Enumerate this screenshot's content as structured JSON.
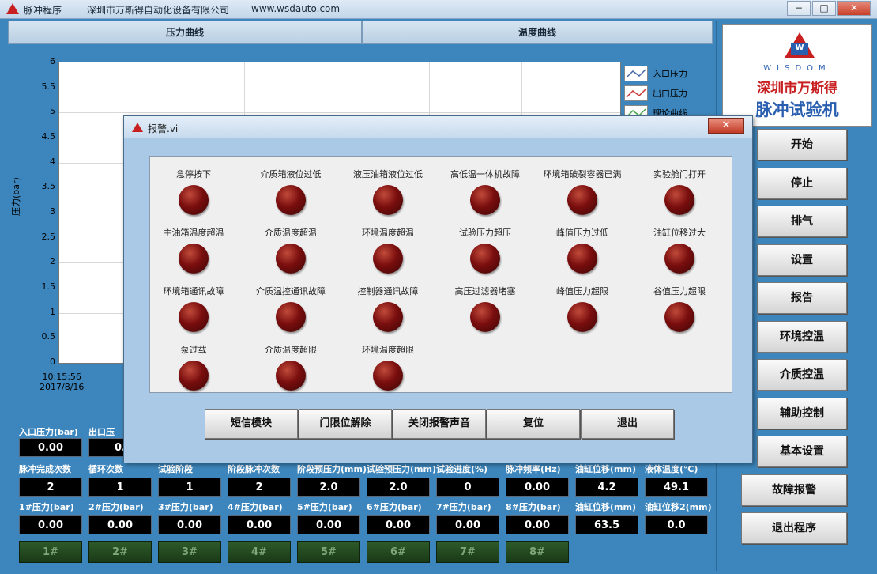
{
  "titlebar": {
    "app_name": "脉冲程序",
    "company": "深圳市万斯得自动化设备有限公司",
    "url": "www.wsdauto.com",
    "min": "−",
    "max": "□",
    "close": "✕"
  },
  "tabs": [
    "压力曲线",
    "温度曲线"
  ],
  "graph": {
    "ylabel": "压力(bar)",
    "yticks": [
      "6",
      "5.5",
      "5",
      "4.5",
      "4",
      "3.5",
      "3",
      "2.5",
      "2",
      "1.5",
      "1",
      "0.5",
      "0"
    ],
    "time": "10:15:56",
    "date": "2017/8/16",
    "legend": [
      "入口压力",
      "出口压力",
      "理论曲线"
    ]
  },
  "brand": {
    "logo_letter": "W",
    "en": "WISDOM",
    "cn1": "深圳市万斯得",
    "cn2": "脉冲试验机"
  },
  "right_buttons": [
    "开始",
    "停止",
    "排气",
    "设置",
    "报告",
    "环境控温",
    "介质控温",
    "辅助控制",
    "基本设置",
    "故障报警",
    "退出程序"
  ],
  "readings": {
    "row0_labels": [
      "入口压力(bar)",
      "出口压"
    ],
    "row0_values": [
      "0.00",
      "0."
    ],
    "row1_labels": [
      "脉冲完成次数",
      "循环次数",
      "试验阶段",
      "阶段脉冲次数",
      "阶段预压力(mm)",
      "试验预压力(mm)",
      "试验进度(%)",
      "脉冲频率(Hz)",
      "油缸位移(mm)",
      "液体温度(℃)"
    ],
    "row1_values": [
      "2",
      "1",
      "1",
      "2",
      "2.0",
      "2.0",
      "0",
      "0.00",
      "4.2",
      "49.1"
    ],
    "row2_labels": [
      "1#压力(bar)",
      "2#压力(bar)",
      "3#压力(bar)",
      "4#压力(bar)",
      "5#压力(bar)",
      "6#压力(bar)",
      "7#压力(bar)",
      "8#压力(bar)",
      "油缸位移(mm)",
      "油缸位移2(mm)"
    ],
    "row2_values": [
      "0.00",
      "0.00",
      "0.00",
      "0.00",
      "0.00",
      "0.00",
      "0.00",
      "0.00",
      "63.5",
      "0.0"
    ],
    "lamps": [
      "1#",
      "2#",
      "3#",
      "4#",
      "5#",
      "6#",
      "7#",
      "8#"
    ]
  },
  "dialog": {
    "title": "报警.vi",
    "close": "✕",
    "alarms": [
      "急停按下",
      "介质箱液位过低",
      "液压油箱液位过低",
      "高低温一体机故障",
      "环境箱破裂容器已满",
      "实验舱门打开",
      "主油箱温度超温",
      "介质温度超温",
      "环境温度超温",
      "试验压力超压",
      "峰值压力过低",
      "油缸位移过大",
      "环境箱通讯故障",
      "介质温控通讯故障",
      "控制器通讯故障",
      "高压过滤器堵塞",
      "峰值压力超限",
      "谷值压力超限",
      "泵过载",
      "介质温度超限",
      "环境温度超限"
    ],
    "buttons": [
      "短信模块",
      "门限位解除",
      "关闭报警声音",
      "复位",
      "退出"
    ]
  }
}
